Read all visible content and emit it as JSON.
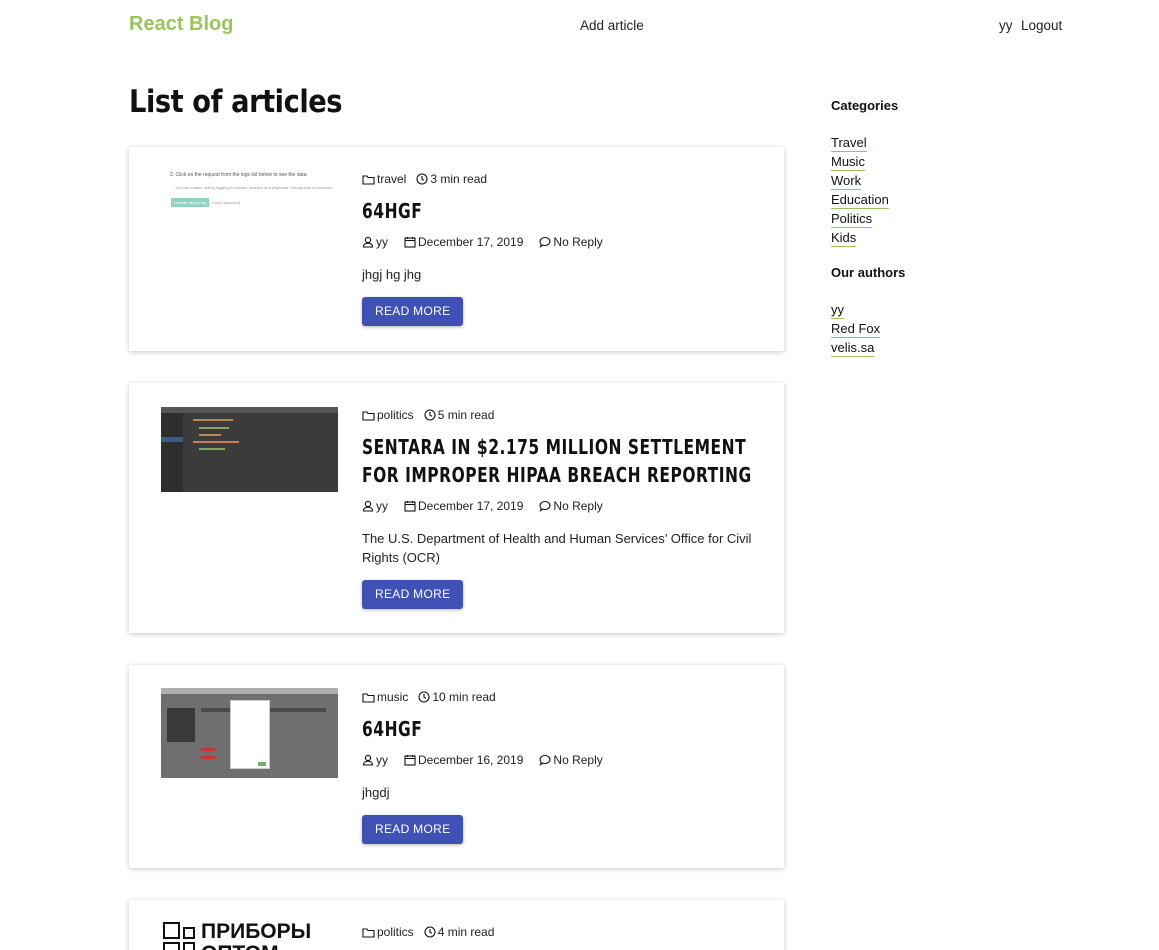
{
  "header": {
    "logo": "React Blog",
    "add_article": "Add article",
    "user": "yy",
    "logout": "Logout"
  },
  "page_title": "List of articles",
  "articles": [
    {
      "category": "travel",
      "read_time": "3 min read",
      "title": "64HGF",
      "author": "yy",
      "date": "December 17, 2019",
      "comments": "No Reply",
      "excerpt": "jhgj hg jhg",
      "button": "READ MORE",
      "thumb_line1": "2. Click on the request from the logs list below to see the data:",
      "thumb_line2": "You can enable debug logging to capture headers and payloads. Debug data is removed",
      "thumb_btn": "Disable debug log",
      "thumb_link": "Copy request id"
    },
    {
      "category": "politics",
      "read_time": "5 min read",
      "title": "SENTARA IN $2.175 MILLION SETTLEMENT FOR IMPROPER HIPAA BREACH REPORTING",
      "author": "yy",
      "date": "December 17, 2019",
      "comments": "No Reply",
      "excerpt": "The U.S. Department of Health and Human Services’ Office for Civil Rights (OCR)",
      "button": "READ MORE"
    },
    {
      "category": "music",
      "read_time": "10 min read",
      "title": "64HGF",
      "author": "yy",
      "date": "December 16, 2019",
      "comments": "No Reply",
      "excerpt": "jhgdj",
      "button": "READ MORE"
    },
    {
      "category": "politics",
      "read_time": "4 min read",
      "thumb_text1": "ПРИБОРЫ",
      "thumb_text2": "ОПТОМ"
    }
  ],
  "sidebar": {
    "categories_title": "Categories",
    "categories": [
      "Travel",
      "Music",
      "Work",
      "Education",
      "Politics",
      "Kids"
    ],
    "authors_title": "Our authors",
    "authors": [
      "yy",
      "Red Fox",
      "velis.sa"
    ]
  },
  "colors": {
    "brand": "#9ac45e",
    "button": "#3f51b5"
  }
}
